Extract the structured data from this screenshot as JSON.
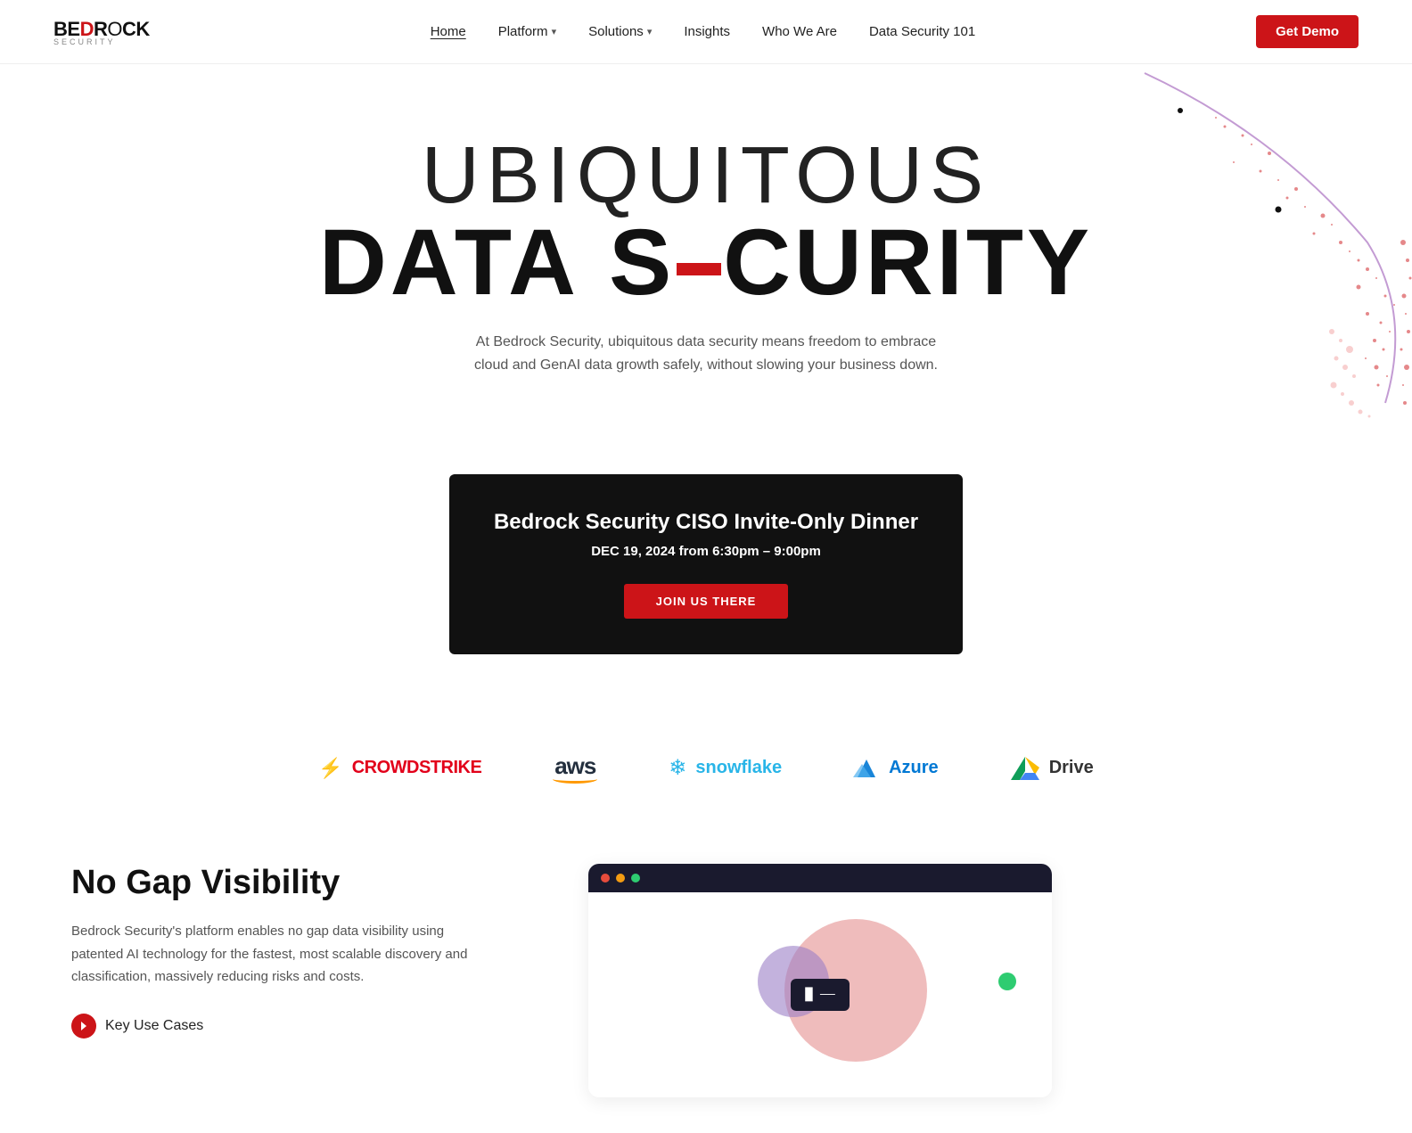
{
  "navbar": {
    "logo": {
      "line1": "BEDrOCK",
      "line2": "SECURITY"
    },
    "links": [
      {
        "label": "Home",
        "active": true,
        "has_arrow": false
      },
      {
        "label": "Platform",
        "active": false,
        "has_arrow": true
      },
      {
        "label": "Solutions",
        "active": false,
        "has_arrow": true
      },
      {
        "label": "Insights",
        "active": false,
        "has_arrow": false
      },
      {
        "label": "Who We Are",
        "active": false,
        "has_arrow": false
      },
      {
        "label": "Data Security 101",
        "active": false,
        "has_arrow": false
      }
    ],
    "cta": "Get Demo"
  },
  "hero": {
    "title_line1": "UBIQUITOUS",
    "title_line2_part1": "DATA S",
    "title_line2_part2": "CURITY",
    "subtitle": "At Bedrock Security, ubiquitous data security means freedom to embrace cloud and GenAI data growth safely, without slowing your business down."
  },
  "event": {
    "title": "Bedrock Security CISO Invite-Only Dinner",
    "date": "DEC 19, 2024 from 6:30pm – 9:00pm",
    "cta": "JOIN US THERE"
  },
  "partners": [
    {
      "name": "CrowdStrike",
      "type": "crowdstrike"
    },
    {
      "name": "aws",
      "type": "aws"
    },
    {
      "name": "snowflake",
      "type": "snowflake"
    },
    {
      "name": "Azure",
      "type": "azure"
    },
    {
      "name": "Drive",
      "type": "gdrive"
    }
  ],
  "bottom": {
    "title": "No Gap Visibility",
    "description": "Bedrock Security's platform enables no gap data visibility using patented AI technology for the fastest, most scalable discovery and classification, massively reducing risks and costs.",
    "key_use_cases_label": "Key Use Cases",
    "dashboard_widget_text": "█ ——"
  }
}
